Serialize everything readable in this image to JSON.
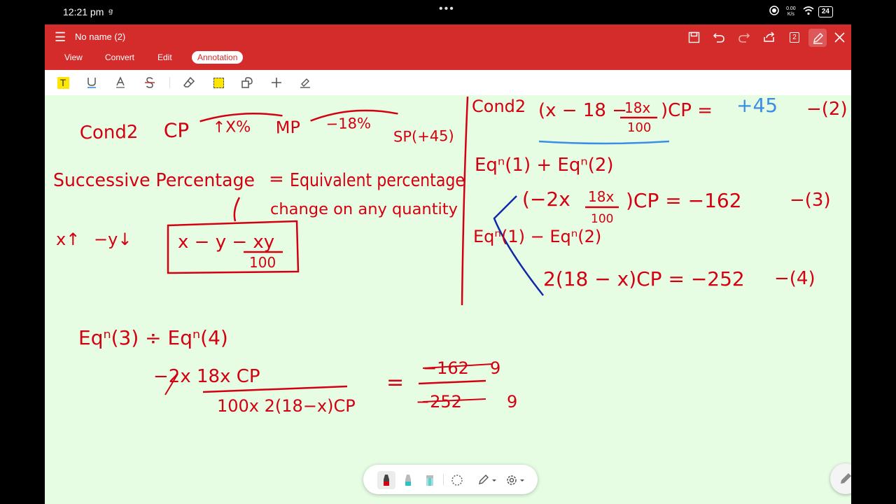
{
  "status": {
    "time": "12:21 pm",
    "time_suffix": "ꞡ",
    "dots": "•••",
    "net_speed": "0.00 K/s",
    "battery": "24"
  },
  "app": {
    "title": "No name (2)",
    "tabs": [
      {
        "label": "View"
      },
      {
        "label": "Convert"
      },
      {
        "label": "Edit"
      },
      {
        "label": "Annotation",
        "active": true
      }
    ],
    "page_count": "2"
  },
  "colors": {
    "titlebar": "#d42b2b",
    "canvas": "#e6fde4",
    "ink_red": "#d40012",
    "ink_blue": "#3a8ee6",
    "ink_navy": "#1029a8"
  },
  "annotation_tools": [
    "highlight-tool",
    "underline-tool",
    "text-color-tool",
    "strikethrough-tool",
    "eraser-tool",
    "area-select-tool",
    "shape-tool",
    "add-tool",
    "signature-tool"
  ],
  "notes": {
    "cond2_left": "Cond2",
    "cp_left": "CP",
    "arrow_up_x": "↑X%",
    "mp": "MP",
    "minus18": "−18%",
    "sp": "SP(+45)",
    "successive": "Successive Percentage",
    "equals": "=",
    "equivalent": "Equivalent percentage",
    "change_on": "change on any quantity",
    "x_up": "x↑",
    "y_down": "−y↓",
    "formula_top": "x − y − xy",
    "formula_bottom": "100",
    "cond2_right": "Cond2",
    "eq2_open": "(x − 18 − ",
    "eq2_frac_top": "18x",
    "eq2_frac_bottom": "100",
    "eq2_close": ")CP =",
    "eq2_rhs": "+45",
    "eq2_tag": "−(2)",
    "eqn1_plus_eqn2": "Eqⁿ(1) + Eqⁿ(2)",
    "eq3_open": "(−2x",
    "eq3_frac_top": "18x",
    "eq3_frac_bottom": "100",
    "eq3_close": ")CP = −162",
    "eq3_tag": "−(3)",
    "eqn1_minus_eqn2": "Eqⁿ(1) − Eqⁿ(2)",
    "eq4": "2(18 − x)CP = −252",
    "eq4_tag": "−(4)",
    "eqn3_div_eqn4": "Eqⁿ(3) ÷ Eqⁿ(4)",
    "div_num": "−2x 18x CP",
    "div_den": "100x 2(18−x)CP",
    "div_eq": "=",
    "rhs_num": "−162",
    "rhs_num_reduced": "9",
    "rhs_den": "−252",
    "rhs_den_reduced": "9"
  }
}
